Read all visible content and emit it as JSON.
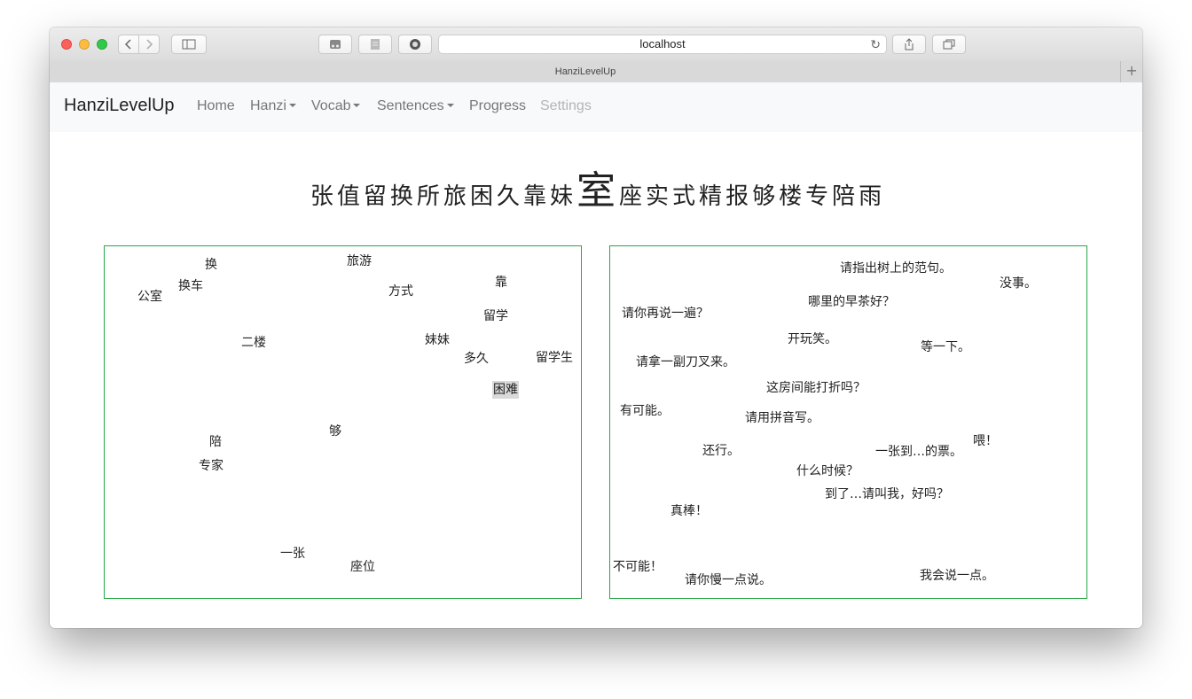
{
  "browser": {
    "url": "localhost",
    "tab_title": "HanziLevelUp",
    "icons": [
      "back-icon",
      "forward-icon",
      "sidebar-icon",
      "bookmarks-icon",
      "reader-icon",
      "extension-icon",
      "reload-icon",
      "share-icon",
      "tabs-icon",
      "new-tab-icon"
    ]
  },
  "navbar": {
    "brand": "HanziLevelUp",
    "items": [
      {
        "label": "Home"
      },
      {
        "label": "Hanzi"
      },
      {
        "label": "Vocab"
      },
      {
        "label": "Sentences"
      },
      {
        "label": "Progress"
      },
      {
        "label": "Settings"
      }
    ]
  },
  "hanzi_row": [
    "张",
    "值",
    "留",
    "换",
    "所",
    "旅",
    "困",
    "久",
    "靠",
    "妹",
    "室",
    "座",
    "实",
    "式",
    "精",
    "报",
    "够",
    "楼",
    "专",
    "陪",
    "雨"
  ],
  "hanzi_selected": "室",
  "vocab": [
    {
      "text": "换"
    },
    {
      "text": "旅游"
    },
    {
      "text": "换车"
    },
    {
      "text": "公室"
    },
    {
      "text": "方式"
    },
    {
      "text": "靠"
    },
    {
      "text": "留学"
    },
    {
      "text": "二楼"
    },
    {
      "text": "妹妹"
    },
    {
      "text": "多久"
    },
    {
      "text": "留学生"
    },
    {
      "text": "困难"
    },
    {
      "text": "够"
    },
    {
      "text": "陪"
    },
    {
      "text": "专家"
    },
    {
      "text": "一张"
    },
    {
      "text": "座位"
    }
  ],
  "vocab_highlighted": "困难",
  "sentences": [
    {
      "text": "请指出树上的范句。"
    },
    {
      "text": "没事。"
    },
    {
      "text": "哪里的早茶好？"
    },
    {
      "text": "请你再说一遍？"
    },
    {
      "text": "开玩笑。"
    },
    {
      "text": "等一下。"
    },
    {
      "text": "请拿一副刀叉来。"
    },
    {
      "text": "这房间能打折吗？"
    },
    {
      "text": "有可能。"
    },
    {
      "text": "请用拼音写。"
    },
    {
      "text": "喂！"
    },
    {
      "text": "还行。"
    },
    {
      "text": "一张到…的票。"
    },
    {
      "text": "什么时候？"
    },
    {
      "text": "到了…请叫我，好吗？"
    },
    {
      "text": "真棒！"
    },
    {
      "text": "不可能！"
    },
    {
      "text": "请你慢一点说。"
    },
    {
      "text": "我会说一点。"
    }
  ],
  "colors": {
    "panel_border": "#28a745",
    "navbar_bg": "#f8f9fa",
    "highlight": "#d9d9d9"
  }
}
